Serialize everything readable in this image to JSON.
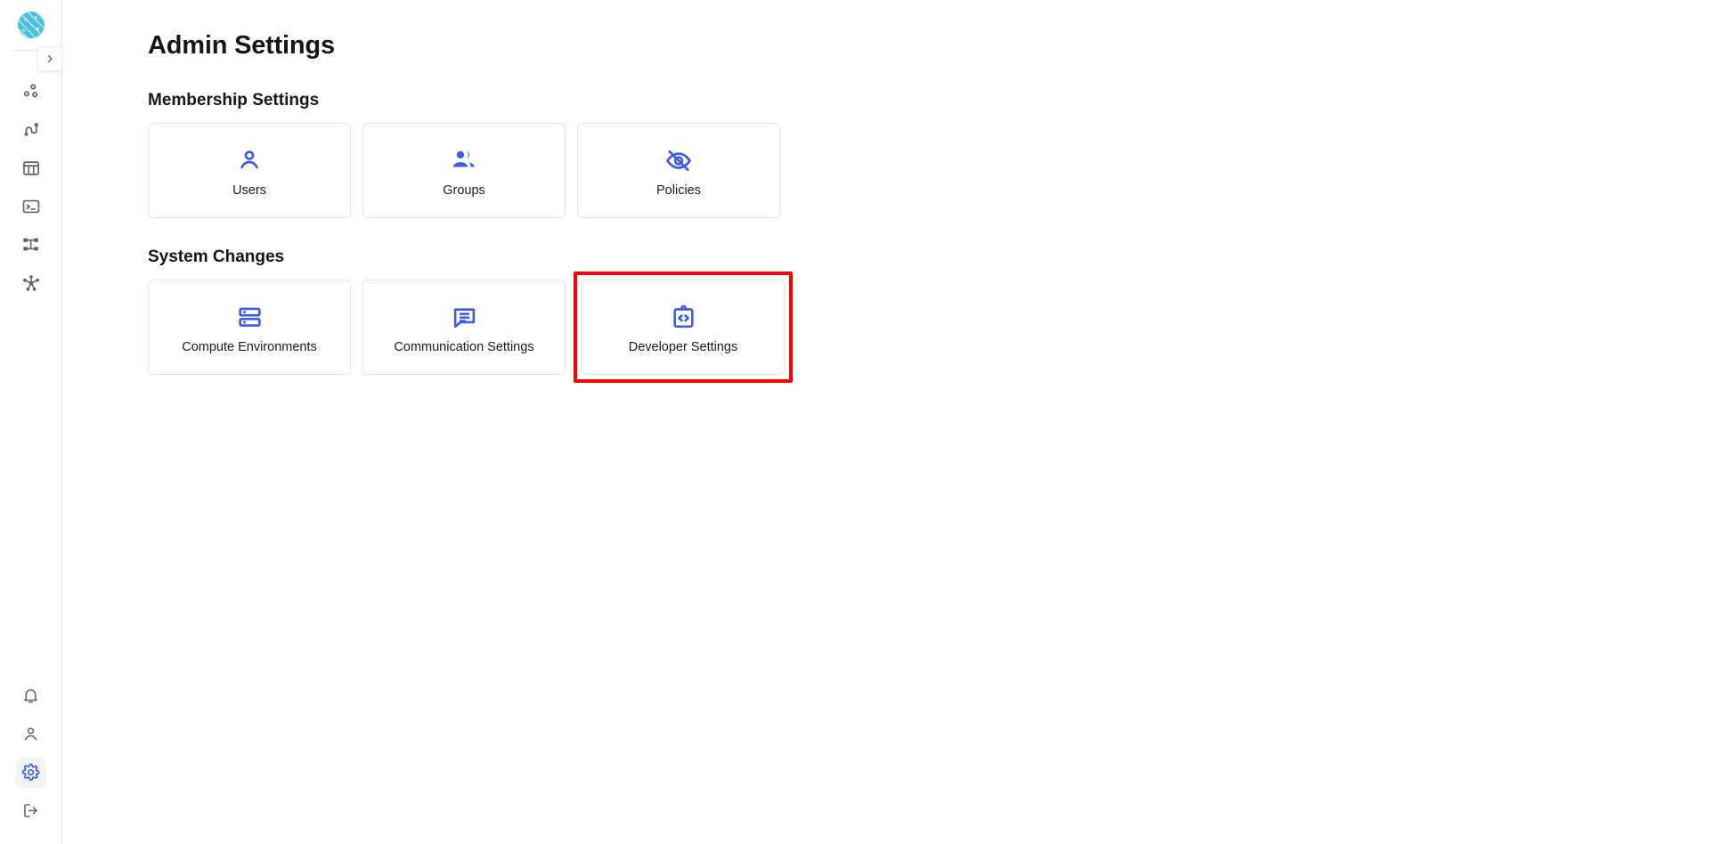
{
  "brand": {
    "logo_icon": "circuit-globe-logo",
    "accent_blue": "#3a5bec",
    "logo_teal": "#4cc0dd"
  },
  "sidebar": {
    "expand_button": {
      "icon": "chevron-right-icon",
      "label": "Expand sidebar"
    },
    "top_items": [
      {
        "icon": "data-points-icon",
        "name": "datasets"
      },
      {
        "icon": "pipeline-icon",
        "name": "pipelines"
      },
      {
        "icon": "table-icon",
        "name": "tables"
      },
      {
        "icon": "terminal-icon",
        "name": "terminal"
      },
      {
        "icon": "sitemap-icon",
        "name": "workflows"
      },
      {
        "icon": "network-hub-icon",
        "name": "network"
      }
    ],
    "bottom_items": [
      {
        "icon": "bell-icon",
        "name": "notifications",
        "active": false
      },
      {
        "icon": "person-icon",
        "name": "account",
        "active": false
      },
      {
        "icon": "gear-icon",
        "name": "settings",
        "active": true
      },
      {
        "icon": "logout-icon",
        "name": "logout",
        "active": false
      }
    ]
  },
  "page": {
    "title": "Admin Settings",
    "sections": [
      {
        "title": "Membership Settings",
        "cards": [
          {
            "label": "Users",
            "icon": "person-icon"
          },
          {
            "label": "Groups",
            "icon": "people-group-icon"
          },
          {
            "label": "Policies",
            "icon": "eye-off-icon"
          }
        ]
      },
      {
        "title": "System Changes",
        "cards": [
          {
            "label": "Compute Environments",
            "icon": "server-rack-icon"
          },
          {
            "label": "Communication Settings",
            "icon": "chat-message-icon"
          },
          {
            "label": "Developer Settings",
            "icon": "code-clipboard-icon",
            "highlighted": true
          }
        ]
      }
    ]
  },
  "highlight": {
    "color": "#ff0000",
    "target": "Developer Settings"
  }
}
